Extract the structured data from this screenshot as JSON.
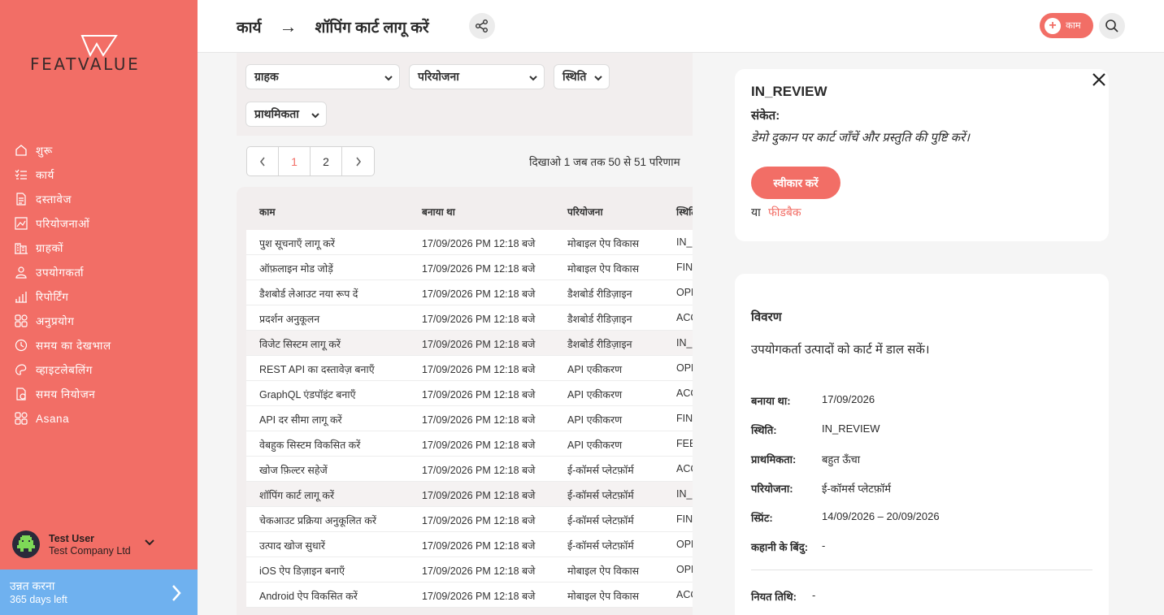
{
  "brand": {
    "name": "FEATVALUE",
    "accent": "#f26e66",
    "upgrade_color": "#6fb1ef"
  },
  "sidebar": {
    "items": [
      {
        "label": "शुरू",
        "icon": "home-icon"
      },
      {
        "label": "कार्य",
        "icon": "tasks-icon"
      },
      {
        "label": "दस्तावेज",
        "icon": "document-icon"
      },
      {
        "label": "परियोजनाओं",
        "icon": "projects-icon"
      },
      {
        "label": "ग्राहकों",
        "icon": "customers-icon"
      },
      {
        "label": "उपयोगकर्ता",
        "icon": "user-icon"
      },
      {
        "label": "रिपोर्टिंग",
        "icon": "reporting-icon"
      },
      {
        "label": "अनुप्रयोग",
        "icon": "apps-icon"
      },
      {
        "label": "समय का देखभाल",
        "icon": "time-tracking-icon"
      },
      {
        "label": "व्हाइटलेबलिंग",
        "icon": "whitelabel-icon"
      },
      {
        "label": "समय नियोजन",
        "icon": "schedule-icon"
      },
      {
        "label": "Asana",
        "icon": "asana-icon"
      }
    ],
    "user": {
      "name": "Test User",
      "company": "Test Company Ltd"
    },
    "upgrade": {
      "label": "उन्नत करना",
      "days_left": "365 days left"
    }
  },
  "header": {
    "crumb_parent": "कार्य",
    "crumb_arrow": "→",
    "crumb_current": "शॉपिंग कार्ट लागू करें",
    "add_label": "काम"
  },
  "filters": {
    "customer": "ग्राहक",
    "project": "परियोजना",
    "status": "स्थिति",
    "priority": "प्राथमिकता"
  },
  "pagination": {
    "pages": [
      "1",
      "2"
    ],
    "active": "1",
    "info": "दिखाओ 1 जब तक 50 से 51 परिणाम"
  },
  "table": {
    "headers": {
      "task": "काम",
      "created": "बनाया था",
      "project": "परियोजना",
      "status": "स्थिति"
    },
    "rows": [
      {
        "task": "पुश सूचनाएँ लागू करें",
        "created": "17/09/2026 PM 12:18 बजे",
        "project": "मोबाइल ऐप विकास",
        "status": "IN_REVIEW"
      },
      {
        "task": "ऑफ़लाइन मोड जोड़ें",
        "created": "17/09/2026 PM 12:18 बजे",
        "project": "मोबाइल ऐप विकास",
        "status": "FINISHED"
      },
      {
        "task": "डैशबोर्ड लेआउट नया रूप दें",
        "created": "17/09/2026 PM 12:18 बजे",
        "project": "डैशबोर्ड रीडिज़ाइन",
        "status": "OPEN"
      },
      {
        "task": "प्रदर्शन अनुकूलन",
        "created": "17/09/2026 PM 12:18 बजे",
        "project": "डैशबोर्ड रीडिज़ाइन",
        "status": "ACCEPTED"
      },
      {
        "task": "विजेट सिस्टम लागू करें",
        "created": "17/09/2026 PM 12:18 बजे",
        "project": "डैशबोर्ड रीडिज़ाइन",
        "status": "IN_REVIEW"
      },
      {
        "task": "REST API का दस्तावेज़ बनाएँ",
        "created": "17/09/2026 PM 12:18 बजे",
        "project": "API एकीकरण",
        "status": "OPEN"
      },
      {
        "task": "GraphQL एंडपॉइंट बनाएँ",
        "created": "17/09/2026 PM 12:18 बजे",
        "project": "API एकीकरण",
        "status": "ACCEPTED"
      },
      {
        "task": "API दर सीमा लागू करें",
        "created": "17/09/2026 PM 12:18 बजे",
        "project": "API एकीकरण",
        "status": "FINISHED"
      },
      {
        "task": "वेबहुक सिस्टम विकसित करें",
        "created": "17/09/2026 PM 12:18 बजे",
        "project": "API एकीकरण",
        "status": "FEEDBACK"
      },
      {
        "task": "खोज फ़िल्टर सहेजें",
        "created": "17/09/2026 PM 12:18 बजे",
        "project": "ई-कॉमर्स प्लेटफ़ॉर्म",
        "status": "ACCEPTED"
      },
      {
        "task": "शॉपिंग कार्ट लागू करें",
        "created": "17/09/2026 PM 12:18 बजे",
        "project": "ई-कॉमर्स प्लेटफ़ॉर्म",
        "status": "IN_REVIEW"
      },
      {
        "task": "चेकआउट प्रक्रिया अनुकूलित करें",
        "created": "17/09/2026 PM 12:18 बजे",
        "project": "ई-कॉमर्स प्लेटफ़ॉर्म",
        "status": "FINISHED"
      },
      {
        "task": "उत्पाद खोज सुधारें",
        "created": "17/09/2026 PM 12:18 बजे",
        "project": "ई-कॉमर्स प्लेटफ़ॉर्म",
        "status": "OPEN"
      },
      {
        "task": "iOS ऐप डिज़ाइन बनाएँ",
        "created": "17/09/2026 PM 12:18 बजे",
        "project": "मोबाइल ऐप विकास",
        "status": "OPEN"
      },
      {
        "task": "Android ऐप विकसित करें",
        "created": "17/09/2026 PM 12:18 बजे",
        "project": "मोबाइल ऐप विकास",
        "status": "ACCEPTED"
      }
    ]
  },
  "detail": {
    "status": "IN_REVIEW",
    "hint_label": "संकेत:",
    "hint_text": "डेमो दुकान पर कार्ट जाँचें और प्रस्तुति की पुष्टि करें।",
    "accept_label": "स्वीकार करें",
    "or_label": "या",
    "feedback_label": "फीडबैक",
    "description_title": "विवरण",
    "description": "उपयोगकर्ता उत्पादों को कार्ट में डाल सकें।",
    "fields": [
      {
        "key": "बनाया था:",
        "value": "17/09/2026"
      },
      {
        "key": "स्थिति:",
        "value": "IN_REVIEW"
      },
      {
        "key": "प्राथमिकता:",
        "value": "बहुत ऊँचा"
      },
      {
        "key": "परियोजना:",
        "value": "ई-कॉमर्स प्लेटफ़ॉर्म"
      },
      {
        "key": "स्प्रिंट:",
        "value": "14/09/2026 – 20/09/2026"
      },
      {
        "key": "कहानी के बिंदु:",
        "value": "-"
      }
    ],
    "due_label": "नियत तिथि:",
    "due_value": "-"
  }
}
